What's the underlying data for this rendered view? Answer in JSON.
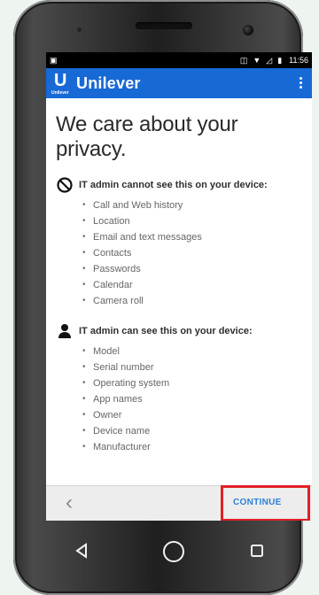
{
  "status_bar": {
    "left_icon": "image-icon",
    "icons": [
      "vibrate-icon",
      "wifi-icon",
      "signal-muted-icon",
      "battery-icon"
    ],
    "time": "11:56"
  },
  "app_bar": {
    "logo_text": "Unilever",
    "title": "Unilever",
    "menu_icon": "overflow-menu-icon",
    "color": "#1769d6"
  },
  "content": {
    "title": "We care about your privacy.",
    "sections": [
      {
        "icon": "prohibited-icon",
        "title": "IT admin cannot see this on your device:",
        "items": [
          "Call and Web history",
          "Location",
          "Email and text messages",
          "Contacts",
          "Passwords",
          "Calendar",
          "Camera roll"
        ]
      },
      {
        "icon": "person-icon",
        "title": "IT admin can see this on your device:",
        "items": [
          "Model",
          "Serial number",
          "Operating system",
          "App names",
          "Owner",
          "Device name",
          "Manufacturer"
        ]
      }
    ]
  },
  "bottom_nav": {
    "back_icon": "chevron-left-icon",
    "continue_label": "CONTINUE",
    "highlight_color": "#e21f26",
    "continue_color": "#2d80d8"
  },
  "device_nav": {
    "back_icon": "triangle-back-icon",
    "home_icon": "circle-home-icon",
    "recents_icon": "square-recents-icon"
  }
}
